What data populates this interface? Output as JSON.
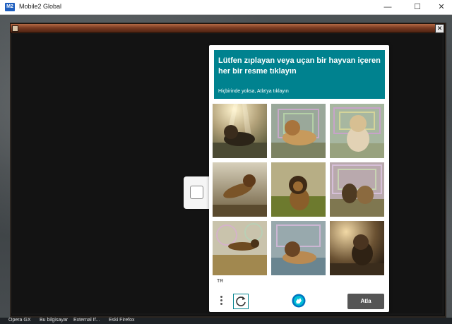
{
  "window": {
    "title": "Mobile2 Global",
    "app_icon_text": "M2",
    "minimize_glyph": "—",
    "maximize_glyph": "☐",
    "close_glyph": "✕"
  },
  "game": {
    "panel_close_glyph": "✕"
  },
  "captcha": {
    "prompt": "Lütfen zıplayan veya uçan bir hayvan içeren her bir resme tıklayın",
    "sub_prompt": "Hiçbirinde yoksa, Atla'ya tıklayın",
    "language": "TR",
    "skip_label": "Atla",
    "accent_color": "#00828f",
    "tiles": [
      {
        "scene": "lion-lying-sun-rays"
      },
      {
        "scene": "lion-resting-pattern"
      },
      {
        "scene": "lion-sitting-pattern"
      },
      {
        "scene": "lion-leaping"
      },
      {
        "scene": "lion-sitting-grass"
      },
      {
        "scene": "lions-pair-pattern"
      },
      {
        "scene": "lion-running-pattern"
      },
      {
        "scene": "lion-lying-water"
      },
      {
        "scene": "lion-sitting-sunset"
      }
    ]
  },
  "taskbar": {
    "items": [
      "Opera GX",
      "Bu bilgisayar",
      "External If...",
      "Eski Firefox"
    ]
  }
}
